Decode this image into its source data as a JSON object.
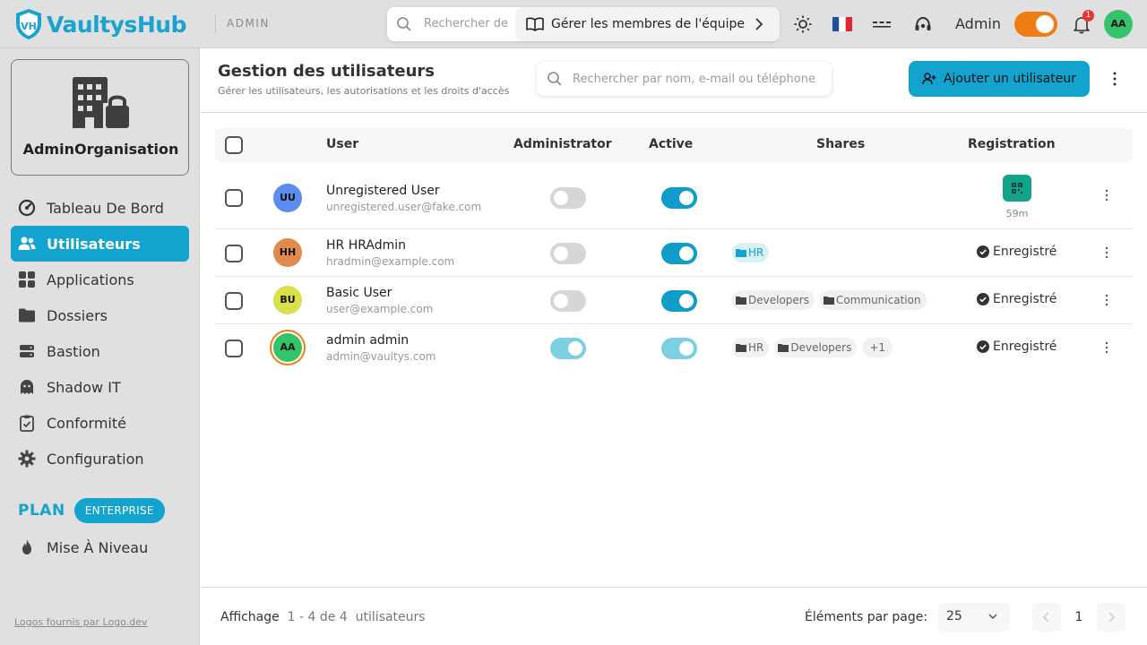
{
  "app": {
    "brand": "VaultysHub",
    "area": "ADMIN",
    "search_placeholder": "Rechercher de",
    "team_link": "Gérer les membres de l'équipe",
    "user_label": "Admin",
    "notifications_count": "1",
    "avatar_initials": "AA",
    "accent_color": "#13a3cf",
    "toggle_color": "#f07d13"
  },
  "sidebar": {
    "org_name": "AdminOrganisation",
    "items": [
      {
        "label": "Tableau De Bord",
        "icon": "dashboard-gauge-icon"
      },
      {
        "label": "Utilisateurs",
        "icon": "users-icon",
        "active": true
      },
      {
        "label": "Applications",
        "icon": "apps-grid-icon"
      },
      {
        "label": "Dossiers",
        "icon": "folder-icon"
      },
      {
        "label": "Bastion",
        "icon": "server-icon"
      },
      {
        "label": "Shadow IT",
        "icon": "ghost-icon"
      },
      {
        "label": "Conformité",
        "icon": "clipboard-check-icon"
      },
      {
        "label": "Configuration",
        "icon": "gear-icon"
      }
    ],
    "plan_label": "PLAN",
    "plan_badge": "ENTERPRISE",
    "upgrade_label": "Mise À Niveau",
    "logos_credit": "Logos fournis par Logo.dev"
  },
  "page": {
    "title": "Gestion des utilisateurs",
    "subtitle": "Gérer les utilisateurs, les autorisations et les droits d'accès",
    "search_placeholder": "Rechercher par nom, e-mail ou téléphone",
    "add_button": "Ajouter un utilisateur"
  },
  "table": {
    "headers": {
      "user": "User",
      "administrator": "Administrator",
      "active": "Active",
      "shares": "Shares",
      "registration": "Registration"
    },
    "rows": [
      {
        "initials": "UU",
        "avatar_color": "#5b8def",
        "name": "Unregistered User",
        "email": "unregistered.user@fake.com",
        "admin": false,
        "active": true,
        "shares": [],
        "registration": "qr",
        "registration_time": "59m"
      },
      {
        "initials": "HH",
        "avatar_color": "#e08a4c",
        "name": "HR HRAdmin",
        "email": "hradmin@example.com",
        "admin": false,
        "active": true,
        "shares": [
          {
            "label": "HR",
            "highlight": true
          }
        ],
        "registration": "Enregistré"
      },
      {
        "initials": "BU",
        "avatar_color": "#d9e04a",
        "name": "Basic User",
        "email": "user@example.com",
        "admin": false,
        "active": true,
        "shares": [
          {
            "label": "Developers"
          },
          {
            "label": "Communication"
          }
        ],
        "registration": "Enregistré"
      },
      {
        "initials": "AA",
        "avatar_color": "#33c46a",
        "name": "admin admin",
        "email": "admin@vaultys.com",
        "admin": true,
        "active": true,
        "shares": [
          {
            "label": "HR"
          },
          {
            "label": "Developers"
          }
        ],
        "shares_more": "+1",
        "registration": "Enregistré"
      }
    ]
  },
  "footer": {
    "showing_label": "Affichage",
    "range": "1 - 4 de 4",
    "entity": "utilisateurs",
    "per_page_label": "Éléments par page:",
    "per_page": "25",
    "current_page": "1"
  }
}
